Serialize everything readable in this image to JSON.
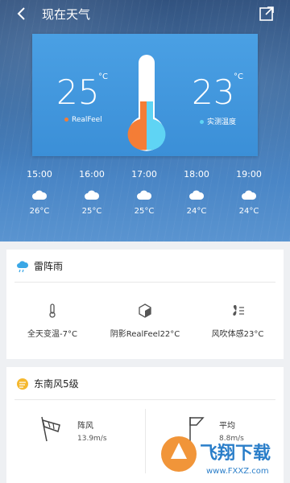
{
  "header": {
    "title": "现在天气"
  },
  "current": {
    "realfeel_value": "25",
    "realfeel_unit": "°C",
    "realfeel_label": "RealFeel",
    "actual_value": "23",
    "actual_unit": "°C",
    "actual_label": "实测温度",
    "realfeel_color": "#f47d36",
    "actual_color": "#5fd4f4"
  },
  "hourly": [
    {
      "time": "15:00",
      "temp": "26°C",
      "icon": "cloud-icon"
    },
    {
      "time": "16:00",
      "temp": "25°C",
      "icon": "cloud-icon"
    },
    {
      "time": "17:00",
      "temp": "25°C",
      "icon": "cloud-icon"
    },
    {
      "time": "18:00",
      "temp": "24°C",
      "icon": "cloud-icon"
    },
    {
      "time": "19:00",
      "temp": "24°C",
      "icon": "cloud-icon"
    }
  ],
  "condition_card": {
    "title": "雷阵雨",
    "metrics": [
      {
        "label": "全天变温-7°C",
        "icon": "thermometer-icon"
      },
      {
        "label": "阴影RealFeel22°C",
        "icon": "shade-cube-icon"
      },
      {
        "label": "风吹体感23°C",
        "icon": "fan-icon"
      }
    ]
  },
  "wind_card": {
    "title": "东南风5级",
    "gust_label": "阵风",
    "gust_value": "13.9m/s",
    "avg_label": "平均",
    "avg_value": "8.8m/s"
  },
  "watermark": {
    "text": "飞翔下载",
    "url": "www.FXXZ.com"
  },
  "colors": {
    "accent": "#3b8fd7",
    "realfeel": "#f47d36",
    "actual": "#5fd4f4"
  }
}
